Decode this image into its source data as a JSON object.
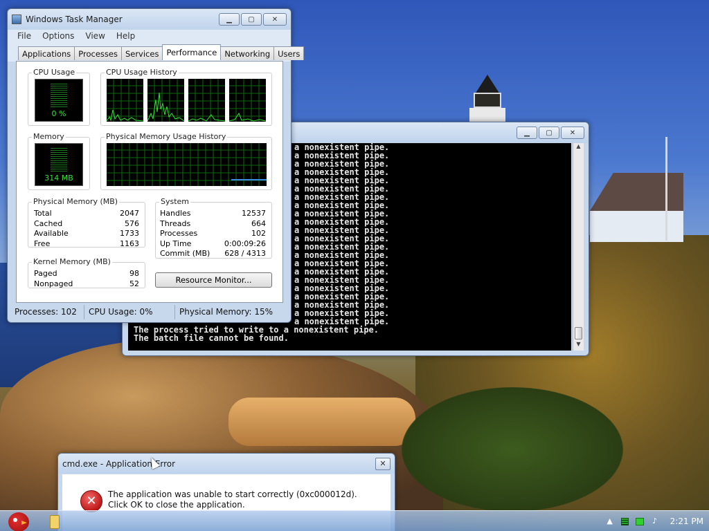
{
  "taskmgr": {
    "title": "Windows Task Manager",
    "menu": [
      "File",
      "Options",
      "View",
      "Help"
    ],
    "tabs": [
      "Applications",
      "Processes",
      "Services",
      "Performance",
      "Networking",
      "Users"
    ],
    "active_tab": "Performance",
    "cpu_usage": {
      "label": "CPU Usage",
      "value": "0 %"
    },
    "cpu_history": {
      "label": "CPU Usage History"
    },
    "memory": {
      "label": "Memory",
      "value": "314 MB"
    },
    "mem_history": {
      "label": "Physical Memory Usage History"
    },
    "physical_memory": {
      "label": "Physical Memory (MB)",
      "rows": [
        {
          "k": "Total",
          "v": "2047"
        },
        {
          "k": "Cached",
          "v": "576"
        },
        {
          "k": "Available",
          "v": "1733"
        },
        {
          "k": "Free",
          "v": "1163"
        }
      ]
    },
    "kernel_memory": {
      "label": "Kernel Memory (MB)",
      "rows": [
        {
          "k": "Paged",
          "v": "98"
        },
        {
          "k": "Nonpaged",
          "v": "52"
        }
      ]
    },
    "system": {
      "label": "System",
      "rows": [
        {
          "k": "Handles",
          "v": "12537"
        },
        {
          "k": "Threads",
          "v": "664"
        },
        {
          "k": "Processes",
          "v": "102"
        },
        {
          "k": "Up Time",
          "v": "0:00:09:26"
        },
        {
          "k": "Commit (MB)",
          "v": "628 / 4313"
        }
      ]
    },
    "resource_monitor_label": "Resource Monitor...",
    "status": {
      "processes": "Processes: 102",
      "cpu": "CPU Usage: 0%",
      "memory": "Physical Memory: 15%"
    }
  },
  "console": {
    "repeat_line": "a nonexistent pipe.",
    "last_lines": [
      "The process tried to write to a nonexistent pipe.",
      "The batch file cannot be found."
    ]
  },
  "error_dialog": {
    "title": "cmd.exe - Application Error",
    "message": "The application was unable to start correctly (0xc000012d). Click OK to close the application."
  },
  "taskbar": {
    "time": "2:21 PM"
  }
}
